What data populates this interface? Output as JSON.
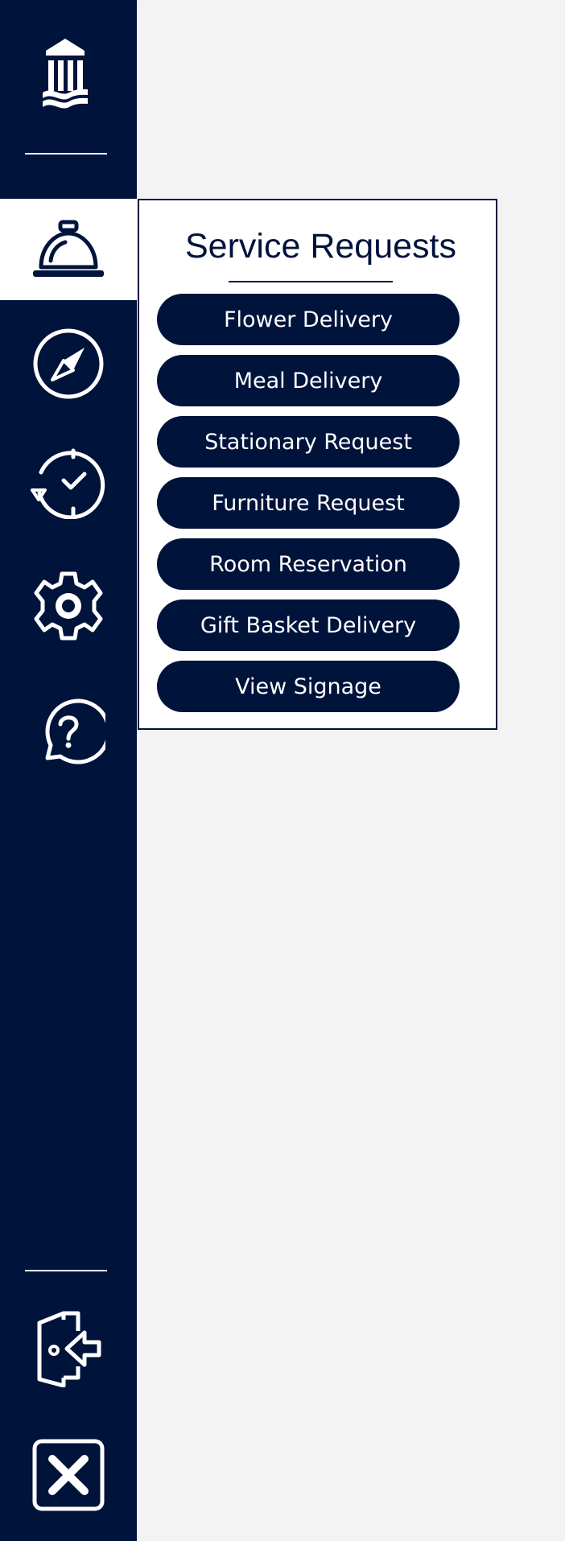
{
  "sidebar": {
    "logo_icon": "institution-columns-logo-icon",
    "items": [
      {
        "name": "service-requests",
        "icon": "service-bell-icon",
        "active": true
      },
      {
        "name": "navigation",
        "icon": "compass-icon",
        "active": false
      },
      {
        "name": "history",
        "icon": "clock-history-icon",
        "active": false
      },
      {
        "name": "settings",
        "icon": "gear-icon",
        "active": false
      },
      {
        "name": "help",
        "icon": "help-chat-icon",
        "active": false
      }
    ],
    "bottom": [
      {
        "name": "logout",
        "icon": "exit-door-icon"
      },
      {
        "name": "close",
        "icon": "close-icon"
      }
    ]
  },
  "panel": {
    "title": "Service Requests",
    "buttons": [
      "Flower Delivery",
      "Meal Delivery",
      "Stationary Request",
      "Furniture Request",
      "Room Reservation",
      "Gift Basket Delivery",
      "View Signage"
    ]
  },
  "colors": {
    "navy": "#00133b",
    "white": "#ffffff",
    "background": "#f3f3f3"
  }
}
